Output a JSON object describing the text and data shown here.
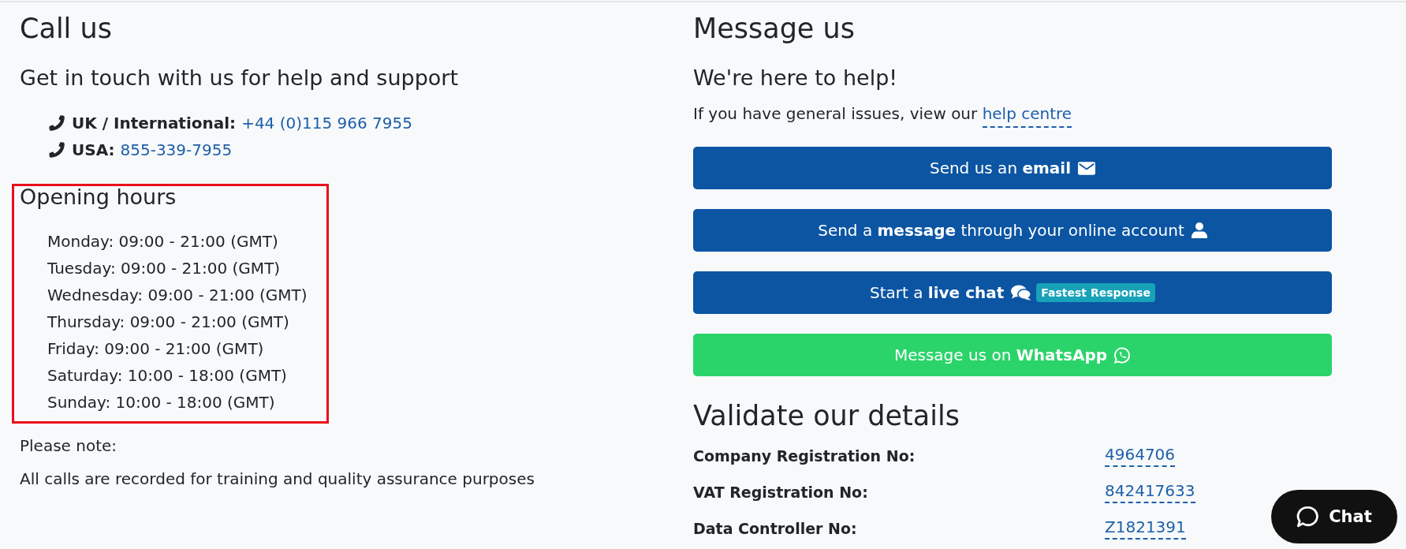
{
  "call_us": {
    "title": "Call us",
    "subtitle": "Get in touch with us for help and support",
    "phones": [
      {
        "label": "UK / International:",
        "number": "+44 (0)115 966 7955"
      },
      {
        "label": "USA:",
        "number": "855-339-7955"
      }
    ]
  },
  "opening_hours": {
    "title": "Opening hours",
    "highlighted": true,
    "days": [
      "Monday: 09:00 - 21:00 (GMT)",
      "Tuesday: 09:00 - 21:00 (GMT)",
      "Wednesday: 09:00 - 21:00 (GMT)",
      "Thursday: 09:00 - 21:00 (GMT)",
      "Friday: 09:00 - 21:00 (GMT)",
      "Saturday: 10:00 - 18:00 (GMT)",
      "Sunday: 10:00 - 18:00 (GMT)"
    ]
  },
  "note": {
    "title": "Please note:",
    "text": "All calls are recorded for training and quality assurance purposes"
  },
  "message_us": {
    "title": "Message us",
    "subtitle": "We're here to help!",
    "help_text": "If you have general issues, view our",
    "help_link": "help centre",
    "buttons": [
      {
        "kind": "email",
        "label": "Send us an **email**"
      },
      {
        "kind": "account",
        "label": "Send a **message** through your online account"
      },
      {
        "kind": "chat",
        "label": "Start a **live chat**",
        "badge": "Fastest Response"
      },
      {
        "kind": "whatsapp",
        "label": "Message us on **WhatsApp**"
      }
    ]
  },
  "validate": {
    "title": "Validate our details",
    "rows": [
      {
        "label": "Company Registration No:",
        "value": "4964706"
      },
      {
        "label": "VAT Registration No:",
        "value": "842417633"
      },
      {
        "label": "Data Controller No:",
        "value": "Z1821391"
      }
    ]
  },
  "chat_widget": {
    "label": "Chat"
  }
}
